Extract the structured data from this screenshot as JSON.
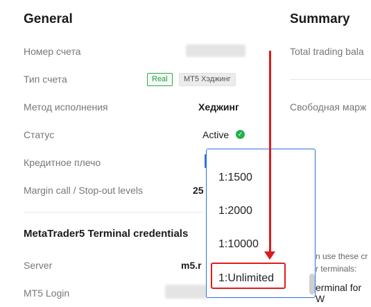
{
  "general": {
    "title": "General",
    "rows": [
      {
        "label": "Номер счета"
      },
      {
        "label": "Тип счета",
        "badge_real": "Real",
        "badge_type": "MT5 Хэджинг"
      },
      {
        "label": "Метод исполнения",
        "value": "Хеджинг"
      },
      {
        "label": "Статус",
        "value": "Active"
      },
      {
        "label": "Кредитное плечо"
      },
      {
        "label": "Margin call / Stop-out levels",
        "value": "25"
      }
    ]
  },
  "credentials": {
    "title": "MetaTrader5 Terminal credentials",
    "server_label": "Server",
    "server_value": "m5.r",
    "login_label": "MT5 Login"
  },
  "summary": {
    "title": "Summary",
    "total_trading_balance": "Total trading bala",
    "free_margin": "Свободная марж",
    "note_line1": "n use these cr",
    "note_line2": "r terminals:",
    "note_line3": "erminal for W"
  },
  "leverage_dropdown": {
    "options": [
      "1:1500",
      "1:2000",
      "1:10000",
      "1:Unlimited"
    ],
    "selected": "1:Unlimited"
  },
  "colors": {
    "accent_blue": "#2c6fe0",
    "annotation_red": "#dd1a1a",
    "status_green": "#22b14c"
  }
}
